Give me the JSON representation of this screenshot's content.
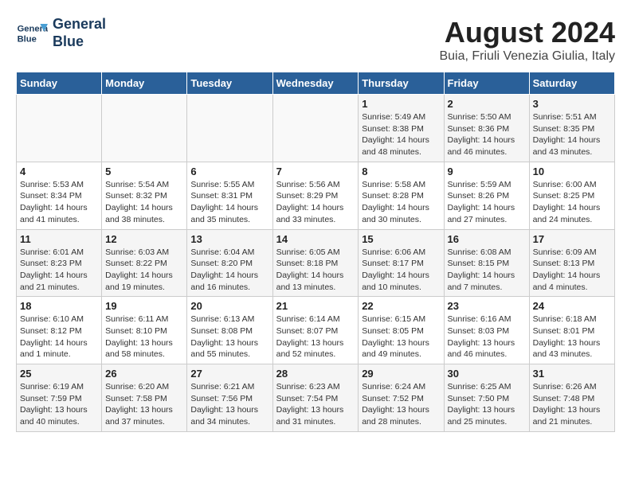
{
  "header": {
    "logo_line1": "General",
    "logo_line2": "Blue",
    "main_title": "August 2024",
    "subtitle": "Buia, Friuli Venezia Giulia, Italy"
  },
  "weekdays": [
    "Sunday",
    "Monday",
    "Tuesday",
    "Wednesday",
    "Thursday",
    "Friday",
    "Saturday"
  ],
  "weeks": [
    [
      {
        "day": "",
        "info": ""
      },
      {
        "day": "",
        "info": ""
      },
      {
        "day": "",
        "info": ""
      },
      {
        "day": "",
        "info": ""
      },
      {
        "day": "1",
        "info": "Sunrise: 5:49 AM\nSunset: 8:38 PM\nDaylight: 14 hours\nand 48 minutes."
      },
      {
        "day": "2",
        "info": "Sunrise: 5:50 AM\nSunset: 8:36 PM\nDaylight: 14 hours\nand 46 minutes."
      },
      {
        "day": "3",
        "info": "Sunrise: 5:51 AM\nSunset: 8:35 PM\nDaylight: 14 hours\nand 43 minutes."
      }
    ],
    [
      {
        "day": "4",
        "info": "Sunrise: 5:53 AM\nSunset: 8:34 PM\nDaylight: 14 hours\nand 41 minutes."
      },
      {
        "day": "5",
        "info": "Sunrise: 5:54 AM\nSunset: 8:32 PM\nDaylight: 14 hours\nand 38 minutes."
      },
      {
        "day": "6",
        "info": "Sunrise: 5:55 AM\nSunset: 8:31 PM\nDaylight: 14 hours\nand 35 minutes."
      },
      {
        "day": "7",
        "info": "Sunrise: 5:56 AM\nSunset: 8:29 PM\nDaylight: 14 hours\nand 33 minutes."
      },
      {
        "day": "8",
        "info": "Sunrise: 5:58 AM\nSunset: 8:28 PM\nDaylight: 14 hours\nand 30 minutes."
      },
      {
        "day": "9",
        "info": "Sunrise: 5:59 AM\nSunset: 8:26 PM\nDaylight: 14 hours\nand 27 minutes."
      },
      {
        "day": "10",
        "info": "Sunrise: 6:00 AM\nSunset: 8:25 PM\nDaylight: 14 hours\nand 24 minutes."
      }
    ],
    [
      {
        "day": "11",
        "info": "Sunrise: 6:01 AM\nSunset: 8:23 PM\nDaylight: 14 hours\nand 21 minutes."
      },
      {
        "day": "12",
        "info": "Sunrise: 6:03 AM\nSunset: 8:22 PM\nDaylight: 14 hours\nand 19 minutes."
      },
      {
        "day": "13",
        "info": "Sunrise: 6:04 AM\nSunset: 8:20 PM\nDaylight: 14 hours\nand 16 minutes."
      },
      {
        "day": "14",
        "info": "Sunrise: 6:05 AM\nSunset: 8:18 PM\nDaylight: 14 hours\nand 13 minutes."
      },
      {
        "day": "15",
        "info": "Sunrise: 6:06 AM\nSunset: 8:17 PM\nDaylight: 14 hours\nand 10 minutes."
      },
      {
        "day": "16",
        "info": "Sunrise: 6:08 AM\nSunset: 8:15 PM\nDaylight: 14 hours\nand 7 minutes."
      },
      {
        "day": "17",
        "info": "Sunrise: 6:09 AM\nSunset: 8:13 PM\nDaylight: 14 hours\nand 4 minutes."
      }
    ],
    [
      {
        "day": "18",
        "info": "Sunrise: 6:10 AM\nSunset: 8:12 PM\nDaylight: 14 hours\nand 1 minute."
      },
      {
        "day": "19",
        "info": "Sunrise: 6:11 AM\nSunset: 8:10 PM\nDaylight: 13 hours\nand 58 minutes."
      },
      {
        "day": "20",
        "info": "Sunrise: 6:13 AM\nSunset: 8:08 PM\nDaylight: 13 hours\nand 55 minutes."
      },
      {
        "day": "21",
        "info": "Sunrise: 6:14 AM\nSunset: 8:07 PM\nDaylight: 13 hours\nand 52 minutes."
      },
      {
        "day": "22",
        "info": "Sunrise: 6:15 AM\nSunset: 8:05 PM\nDaylight: 13 hours\nand 49 minutes."
      },
      {
        "day": "23",
        "info": "Sunrise: 6:16 AM\nSunset: 8:03 PM\nDaylight: 13 hours\nand 46 minutes."
      },
      {
        "day": "24",
        "info": "Sunrise: 6:18 AM\nSunset: 8:01 PM\nDaylight: 13 hours\nand 43 minutes."
      }
    ],
    [
      {
        "day": "25",
        "info": "Sunrise: 6:19 AM\nSunset: 7:59 PM\nDaylight: 13 hours\nand 40 minutes."
      },
      {
        "day": "26",
        "info": "Sunrise: 6:20 AM\nSunset: 7:58 PM\nDaylight: 13 hours\nand 37 minutes."
      },
      {
        "day": "27",
        "info": "Sunrise: 6:21 AM\nSunset: 7:56 PM\nDaylight: 13 hours\nand 34 minutes."
      },
      {
        "day": "28",
        "info": "Sunrise: 6:23 AM\nSunset: 7:54 PM\nDaylight: 13 hours\nand 31 minutes."
      },
      {
        "day": "29",
        "info": "Sunrise: 6:24 AM\nSunset: 7:52 PM\nDaylight: 13 hours\nand 28 minutes."
      },
      {
        "day": "30",
        "info": "Sunrise: 6:25 AM\nSunset: 7:50 PM\nDaylight: 13 hours\nand 25 minutes."
      },
      {
        "day": "31",
        "info": "Sunrise: 6:26 AM\nSunset: 7:48 PM\nDaylight: 13 hours\nand 21 minutes."
      }
    ]
  ]
}
